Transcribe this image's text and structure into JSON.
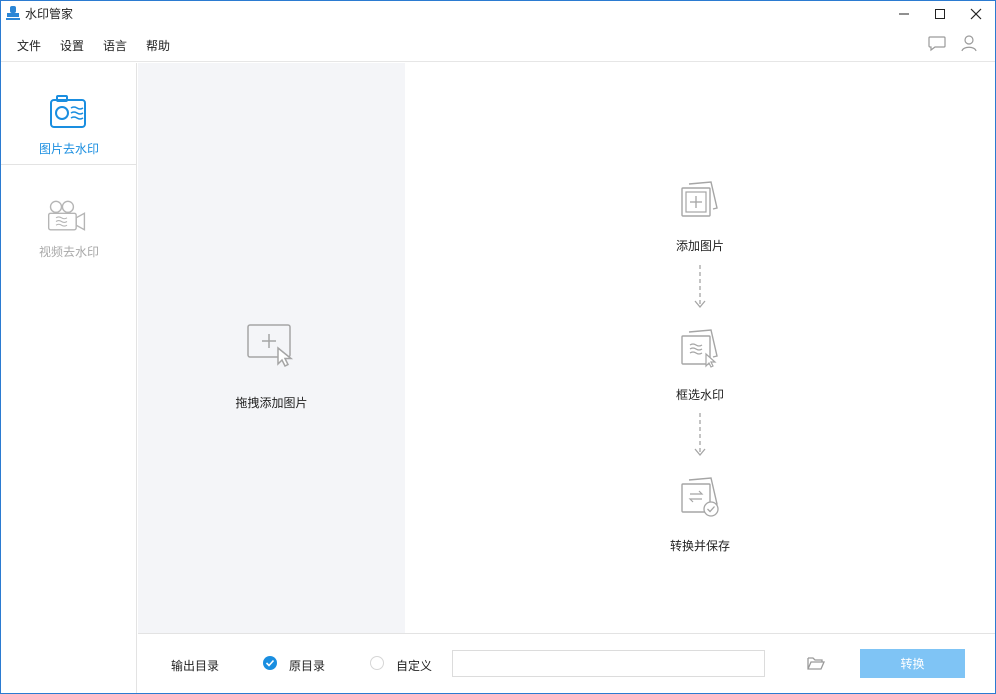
{
  "window": {
    "title": "水印管家",
    "controls": [
      "minimize-icon",
      "maximize-icon",
      "close-icon"
    ]
  },
  "menu": {
    "items": [
      {
        "label": "文件"
      },
      {
        "label": "设置"
      },
      {
        "label": "语言"
      },
      {
        "label": "帮助"
      }
    ],
    "right_icons": [
      "chat-icon",
      "user-icon"
    ]
  },
  "sidebar": {
    "items": [
      {
        "label": "图片去水印",
        "icon": "photo-watermark-icon",
        "active": true
      },
      {
        "label": "视频去水印",
        "icon": "video-camera-icon",
        "active": false
      }
    ]
  },
  "dropzone": {
    "label": "拖拽添加图片",
    "icon": "add-image-cursor-icon"
  },
  "steps": [
    {
      "label": "添加图片",
      "icon": "add-image-icon"
    },
    {
      "label": "框选水印",
      "icon": "select-watermark-icon"
    },
    {
      "label": "转换并保存",
      "icon": "convert-save-icon"
    }
  ],
  "bottom": {
    "output_label": "输出目录",
    "option_original": "原目录",
    "option_custom": "自定义",
    "path_value": "",
    "convert_label": "转换"
  },
  "colors": {
    "accent": "#1a8ee0",
    "convert_button": "#7fc4f5",
    "dropzone_bg": "#f4f5f8",
    "window_border": "#2b7bd1"
  }
}
